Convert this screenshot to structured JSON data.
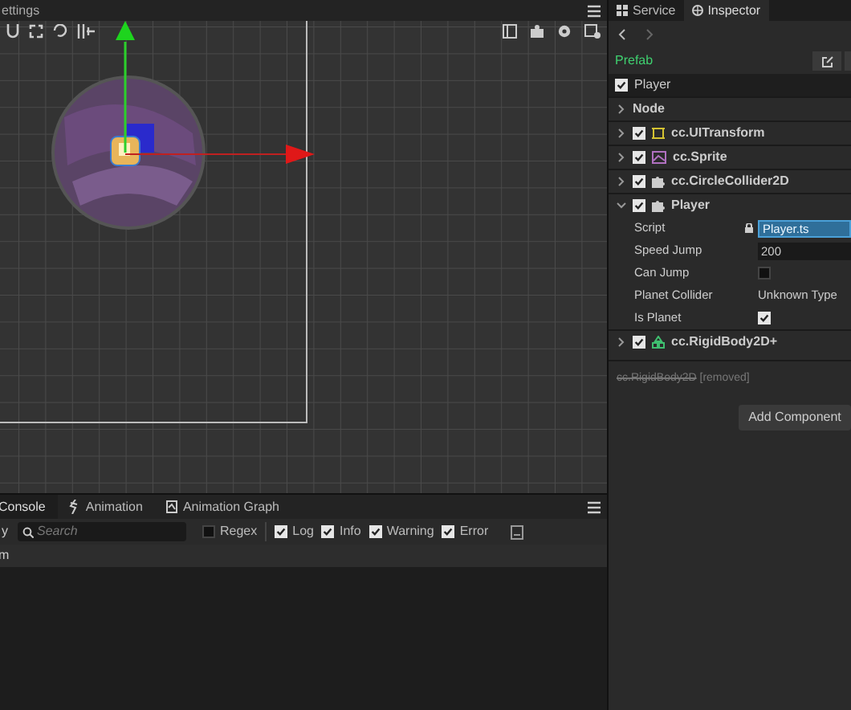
{
  "scene": {
    "title": "ettings"
  },
  "bottom_panel": {
    "tabs": [
      {
        "label": "Console",
        "selected": true
      },
      {
        "label": "Animation",
        "selected": false
      },
      {
        "label": "Animation Graph",
        "selected": false
      }
    ],
    "toolbar": {
      "filter_label": "y",
      "search": {
        "placeholder": "Search"
      },
      "filters": [
        {
          "label": "Regex",
          "checked": false
        },
        {
          "label": "Log",
          "checked": true
        },
        {
          "label": "Info",
          "checked": true
        },
        {
          "label": "Warning",
          "checked": true
        },
        {
          "label": "Error",
          "checked": true
        }
      ]
    },
    "rows": [
      "m"
    ]
  },
  "inspector": {
    "tabs": [
      {
        "label": "Service",
        "selected": false
      },
      {
        "label": "Inspector",
        "selected": true
      }
    ],
    "asset_type": "Prefab",
    "node": {
      "name": "Player",
      "active": true
    },
    "components": [
      {
        "kind": "section",
        "name": "Node",
        "expanded": false
      },
      {
        "kind": "transform",
        "name": "cc.UITransform",
        "expanded": false,
        "enabled": true
      },
      {
        "kind": "sprite",
        "name": "cc.Sprite",
        "expanded": false,
        "enabled": true
      },
      {
        "kind": "script",
        "name": "cc.CircleCollider2D",
        "expanded": false,
        "enabled": true
      },
      {
        "kind": "script",
        "name": "Player",
        "expanded": true,
        "enabled": true,
        "properties": [
          {
            "kind": "asset",
            "label": "Script",
            "value": "Player.ts"
          },
          {
            "kind": "number",
            "label": "Speed Jump",
            "value": "200"
          },
          {
            "kind": "checkbox",
            "label": "Can Jump",
            "checked": false
          },
          {
            "kind": "text",
            "label": "Planet Collider",
            "value": "Unknown Type"
          },
          {
            "kind": "checkbox",
            "label": "Is Planet",
            "checked": true
          }
        ]
      },
      {
        "kind": "rigidbody",
        "name": "cc.RigidBody2D+",
        "expanded": false,
        "enabled": true
      }
    ],
    "removed": {
      "name": "cc.RigidBody2D",
      "note": "[removed]"
    },
    "add_button": "Add Component"
  }
}
